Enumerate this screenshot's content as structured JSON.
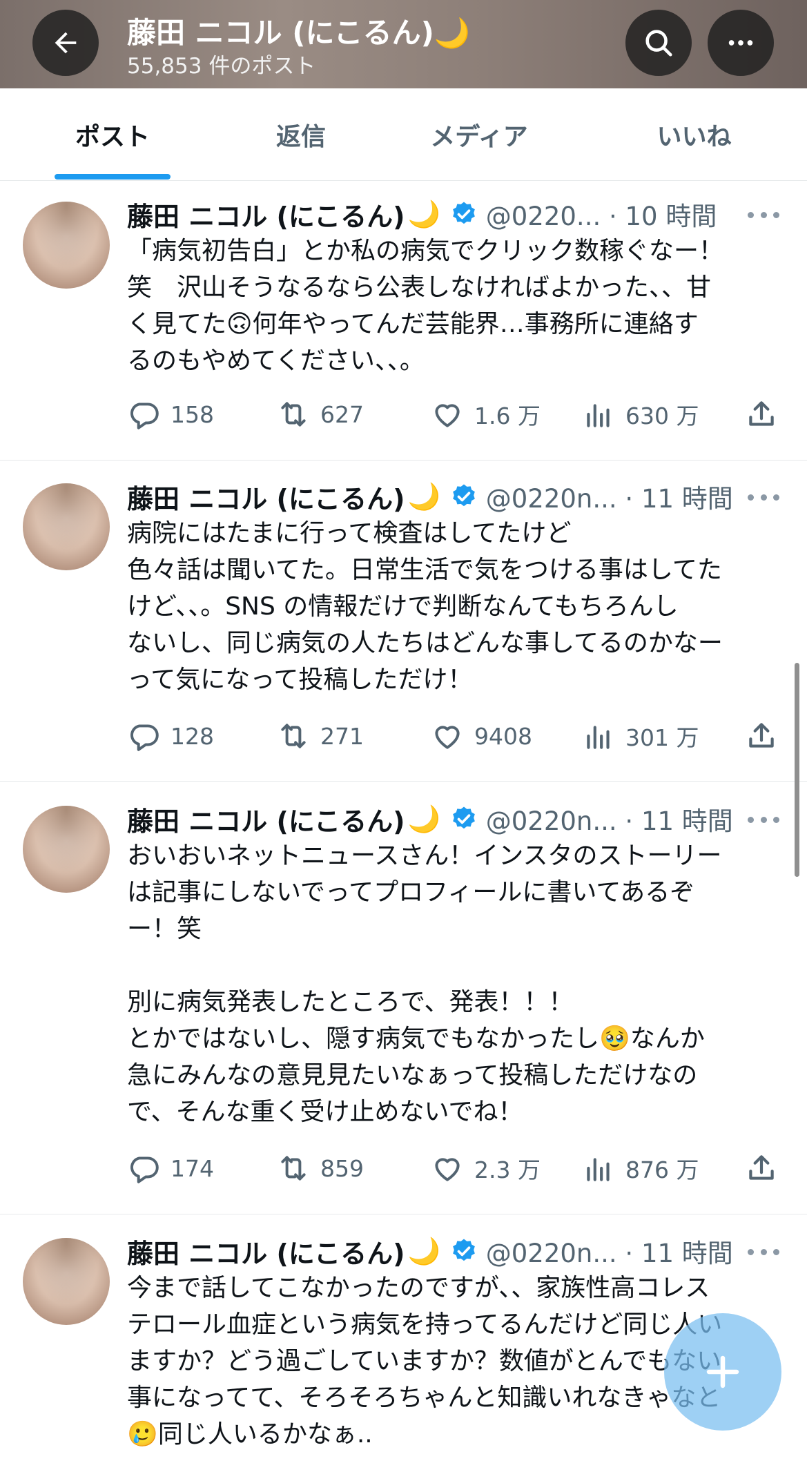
{
  "header": {
    "title": "藤田 ニコル (にこるん)🌙",
    "post_count": "55,853 件のポスト",
    "back_icon": "arrow-left-icon",
    "search_icon": "search-icon",
    "more_icon": "more-horizontal-icon"
  },
  "tabs": [
    {
      "label": "ポスト",
      "active": true
    },
    {
      "label": "返信",
      "active": false
    },
    {
      "label": "メディア",
      "active": false
    },
    {
      "label": "いいね",
      "active": false
    }
  ],
  "posts": [
    {
      "name": "藤田 ニコル (にこるん)",
      "moon": "🌙",
      "handle_time": "@0220... · 10 時間",
      "text": "「病気初告白」とか私の病気でクリック数稼ぐなー！\n笑　沢山そうなるなら公表しなければよかった、、甘\nく見てた🙃何年やってんだ芸能界…事務所に連絡す\nるのもやめてください、、。",
      "replies": "158",
      "reposts": "627",
      "likes": "1.6 万",
      "views": "630 万"
    },
    {
      "name": "藤田 ニコル (にこるん)",
      "moon": "🌙",
      "handle_time": "@0220n... · 11 時間",
      "text": "病院にはたまに行って検査はしてたけど\n色々話は聞いてた。日常生活で気をつける事はしてた\nけど、、。SNS の情報だけで判断なんてもちろんし\nないし、同じ病気の人たちはどんな事してるのかなー\nって気になって投稿しただけ！",
      "replies": "128",
      "reposts": "271",
      "likes": "9408",
      "views": "301 万"
    },
    {
      "name": "藤田 ニコル (にこるん)",
      "moon": "🌙",
      "handle_time": "@0220n... · 11 時間",
      "text": "おいおいネットニュースさん！インスタのストーリー\nは記事にしないでってプロフィールに書いてあるぞ\nー！笑\n\n別に病気発表したところで、発表！！！\nとかではないし、隠す病気でもなかったし🥹なんか\n急にみんなの意見見たいなぁって投稿しただけなの\nで、そんな重く受け止めないでね！",
      "replies": "174",
      "reposts": "859",
      "likes": "2.3 万",
      "views": "876 万"
    },
    {
      "name": "藤田 ニコル (にこるん)",
      "moon": "🌙",
      "handle_time": "@0220n... · 11 時間",
      "text": "今まで話してこなかったのですが、、家族性高コレス\nテロール血症という病気を持ってるんだけど同じ人い\nますか？どう過ごしていますか？数値がとんでもない\n事になってて、そろそろちゃんと知識いれなきゃなと\n🥲同じ人いるかなぁ..",
      "replies": "",
      "reposts": "",
      "likes": "",
      "views": ""
    }
  ],
  "fab": {
    "icon": "compose-plus-icon"
  },
  "colors": {
    "accent": "#1d9bf0",
    "secondary_text": "#536471",
    "verified": "#1d9bf0"
  }
}
